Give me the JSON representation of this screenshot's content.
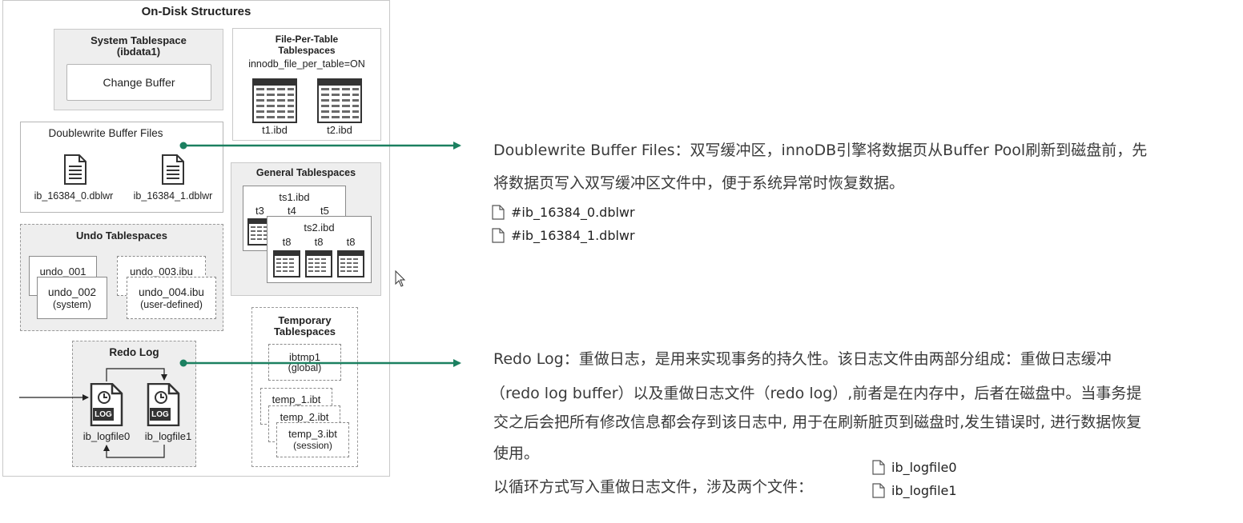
{
  "diagram": {
    "title": "On-Disk Structures",
    "system_ts": {
      "title_line1": "System Tablespace",
      "title_line2": "(ibdata1)",
      "change_buffer": "Change Buffer"
    },
    "fpt": {
      "title_line1": "File-Per-Table",
      "title_line2": "Tablespaces",
      "setting": "innodb_file_per_table=ON",
      "file1": "t1.ibd",
      "file2": "t2.ibd"
    },
    "doublewrite": {
      "title": "Doublewrite Buffer Files",
      "file1": "ib_16384_0.dblwr",
      "file2": "ib_16384_1.dblwr"
    },
    "general": {
      "title": "General Tablespaces",
      "ts1": "ts1.ibd",
      "t3": "t3",
      "t4": "t4",
      "t5": "t5",
      "ts2": "ts2.ibd",
      "t8": "t8"
    },
    "undo": {
      "title": "Undo Tablespaces",
      "u1": "undo_001",
      "u2": "undo_002",
      "u2_sub": "(system)",
      "u3": "undo_003.ibu",
      "u4": "undo_004.ibu",
      "u4_sub": "(user-defined)"
    },
    "temp": {
      "title_line1": "Temporary",
      "title_line2": "Tablespaces",
      "ibtmp": "ibtmp1",
      "ibtmp_sub": "(global)",
      "temp1": "temp_1.ibt",
      "temp2": "temp_2.ibt",
      "temp3": "temp_3.ibt",
      "temp3_sub": "(session)"
    },
    "redo": {
      "title": "Redo Log",
      "log_badge": "LOG",
      "file0": "ib_logfile0",
      "file1": "ib_logfile1"
    }
  },
  "notes": {
    "doublewrite": {
      "line1": "Doublewrite Buffer Files：双写缓冲区，innoDB引擎将数据页从Buffer Pool刷新到磁盘前，先",
      "line2": "将数据页写入双写缓冲区文件中，便于系统异常时恢复数据。",
      "file1": "#ib_16384_0.dblwr",
      "file2": "#ib_16384_1.dblwr"
    },
    "redo": {
      "line1": "Redo Log：重做日志，是用来实现事务的持久性。该日志文件由两部分组成：重做日志缓冲",
      "line2": "（redo log buffer）以及重做日志文件（redo log）,前者是在内存中，后者在磁盘中。当事务提",
      "line3": "交之后会把所有修改信息都会存到该日志中, 用于在刷新脏页到磁盘时,发生错误时, 进行数据恢复",
      "line4": "使用。",
      "line5": "以循环方式写入重做日志文件，涉及两个文件：",
      "file1": "ib_logfile0",
      "file2": "ib_logfile1"
    }
  },
  "colors": {
    "connector": "#1b8060",
    "panel": "#eeeeee",
    "border": "#9a9a9a"
  }
}
